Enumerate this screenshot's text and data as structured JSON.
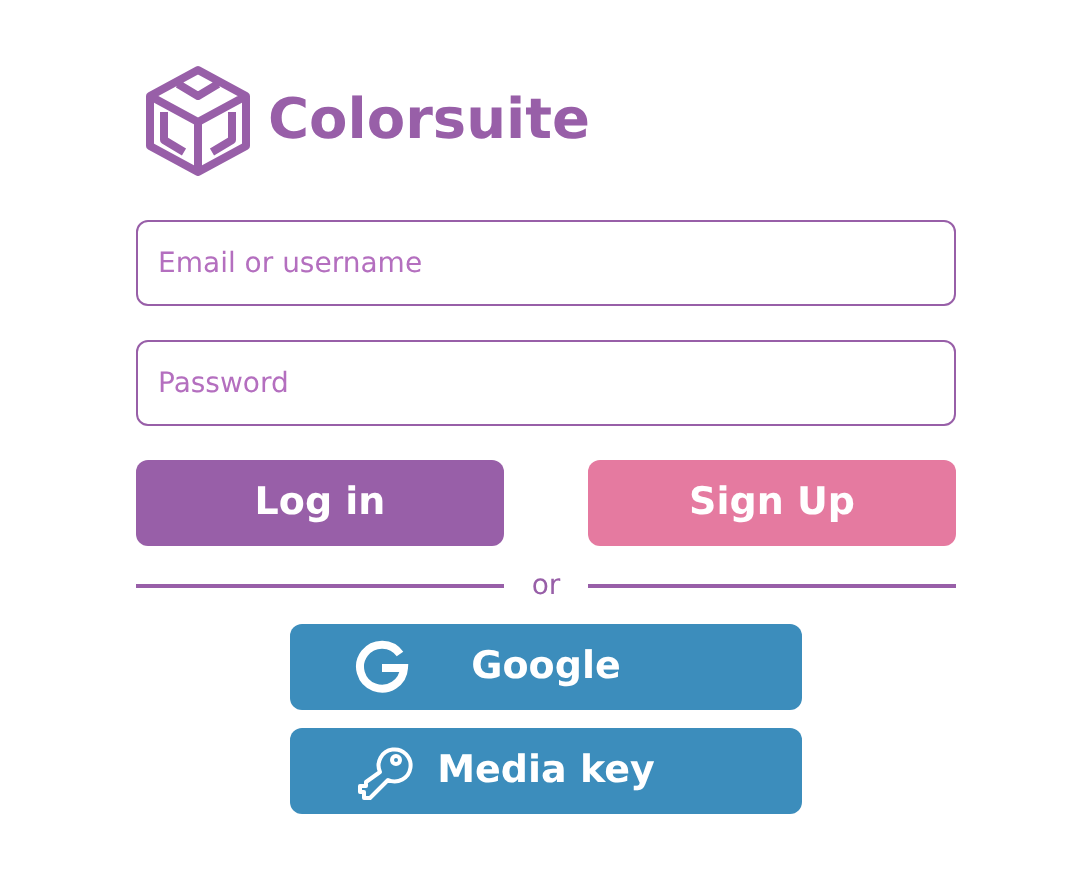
{
  "brand": {
    "name": "Colorsuite"
  },
  "fields": [
    {
      "placeholder": "Email or username"
    },
    {
      "placeholder": "Password"
    }
  ],
  "buttons": [
    {
      "label": "Log in",
      "color": "#985fa8"
    },
    {
      "label": "Sign Up",
      "color": "#e57aa0"
    }
  ],
  "divider": "or",
  "providers": [
    {
      "kind": "google",
      "label": "Google"
    },
    {
      "kind": "key",
      "label": "Media key"
    }
  ]
}
